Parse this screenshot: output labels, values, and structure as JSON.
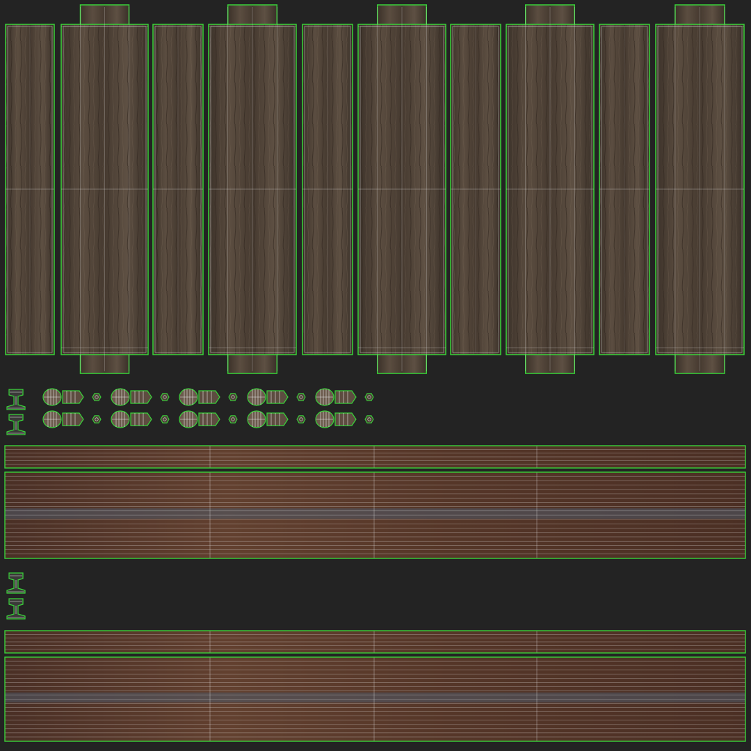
{
  "colors": {
    "background": "#232323",
    "plank_wood": "#4a3f34",
    "plank_wood_dark": "#332a22",
    "plank_wood_light": "#6a5b4c",
    "rail_wood": "#5a3a2c",
    "rail_wood_dark": "#3e271e",
    "rail_steel": "#4f5a68",
    "uv_seam_green": "#39d339",
    "uv_wire_white": "#e9e9e9"
  },
  "uv_layout": {
    "plank_columns": 10,
    "plank_columns_with_extension": 5,
    "bolt_island_rows": 2,
    "bolt_island_groups_per_row": 5,
    "rail_profile_icons": 4,
    "rail_strips": 4,
    "rail_strip_sections": 4
  },
  "icons": {
    "rail_profile": "rail-profile-icon",
    "bolt_head": "bolt-head-icon",
    "bolt_body": "bolt-body-icon",
    "nut": "hex-nut-icon"
  }
}
